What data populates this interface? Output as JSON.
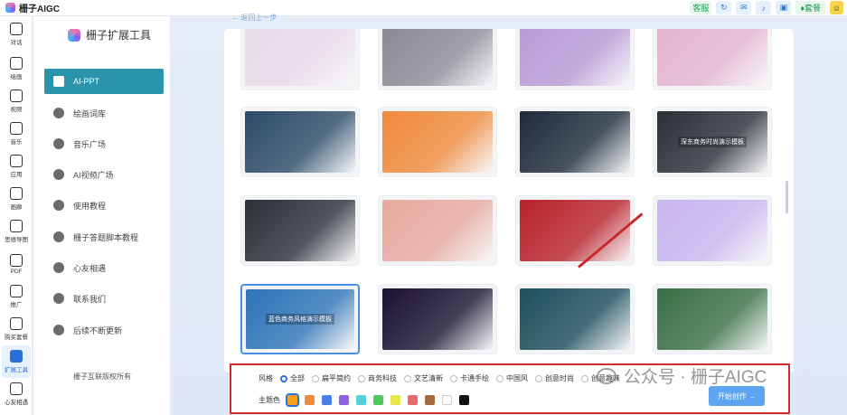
{
  "topbar": {
    "brand": "栅子AIGC",
    "kefu": "客服",
    "vip": "套餐"
  },
  "rail": [
    {
      "label": "对话",
      "icon": "chat-icon"
    },
    {
      "label": "绘画",
      "icon": "brush-icon"
    },
    {
      "label": "视频",
      "icon": "video-icon"
    },
    {
      "label": "音乐",
      "icon": "music-icon"
    },
    {
      "label": "应用",
      "icon": "rocket-icon"
    },
    {
      "label": "画廊",
      "icon": "gallery-icon"
    },
    {
      "label": "思维导图",
      "icon": "mindmap-icon"
    },
    {
      "label": "PDF",
      "icon": "pdf-icon"
    },
    {
      "label": "推广",
      "icon": "diamond-icon"
    },
    {
      "label": "购买套餐",
      "icon": "cart-icon"
    },
    {
      "label": "扩展工具",
      "icon": "toolbox-icon"
    },
    {
      "label": "心友相遇",
      "icon": "heart-icon"
    }
  ],
  "sidebar": {
    "title": "栅子扩展工具",
    "items": [
      {
        "label": "AI-PPT",
        "icon": "document-icon"
      },
      {
        "label": "绘画词库",
        "icon": "robot-icon"
      },
      {
        "label": "音乐广场",
        "icon": "play-icon"
      },
      {
        "label": "AI视频广场",
        "icon": "youtube-icon"
      },
      {
        "label": "使用教程",
        "icon": "book-icon"
      },
      {
        "label": "栅子答题脚本教程",
        "icon": "wordpress-icon"
      },
      {
        "label": "心友相遇",
        "icon": "heartbeat-icon"
      },
      {
        "label": "联系我们",
        "icon": "user-icon"
      },
      {
        "label": "后续不断更新",
        "icon": "cup-icon"
      }
    ],
    "copyright": "栅子互联版权所有"
  },
  "main": {
    "back_link": "← 返回上一步",
    "templates": [
      {
        "label": "",
        "color": "#e9dbe9"
      },
      {
        "label": "",
        "color": "#8a8a94"
      },
      {
        "label": "",
        "color": "#b89ad6"
      },
      {
        "label": "",
        "color": "#e4b5cf"
      },
      {
        "label": "",
        "color": "#2b4a66"
      },
      {
        "label": "",
        "color": "#f08a3c"
      },
      {
        "label": "",
        "color": "#1e2b3a"
      },
      {
        "label": "深东商务时尚演示模板",
        "color": "#2a2f36"
      },
      {
        "label": "",
        "color": "#2a2f38"
      },
      {
        "label": "",
        "color": "#e8a9a0"
      },
      {
        "label": "",
        "color": "#b8212a"
      },
      {
        "label": "",
        "color": "#c7b6ef"
      },
      {
        "label": "蓝色商务风格演示模板",
        "color": "#2d73b7"
      },
      {
        "label": "",
        "color": "#1a1230"
      },
      {
        "label": "",
        "color": "#1d4e5b"
      },
      {
        "label": "",
        "color": "#3a6f45"
      }
    ]
  },
  "filters": {
    "style_label": "风格",
    "styles": [
      "全部",
      "扁平简约",
      "商务科技",
      "文艺清新",
      "卡通手绘",
      "中国风",
      "创意时尚",
      "创意趣味"
    ],
    "selected_style": "全部",
    "theme_label": "主题色",
    "theme_colors": [
      "#f4a11b",
      "#f08a3c",
      "#4c7ee8",
      "#8a63e6",
      "#55d0d8",
      "#4cc956",
      "#e6e64a",
      "#e86b6b",
      "#a66a3a",
      "#ffffff",
      "#111111"
    ],
    "generate_button": "开始创作 →"
  },
  "watermark": "公众号 · 栅子AIGC"
}
